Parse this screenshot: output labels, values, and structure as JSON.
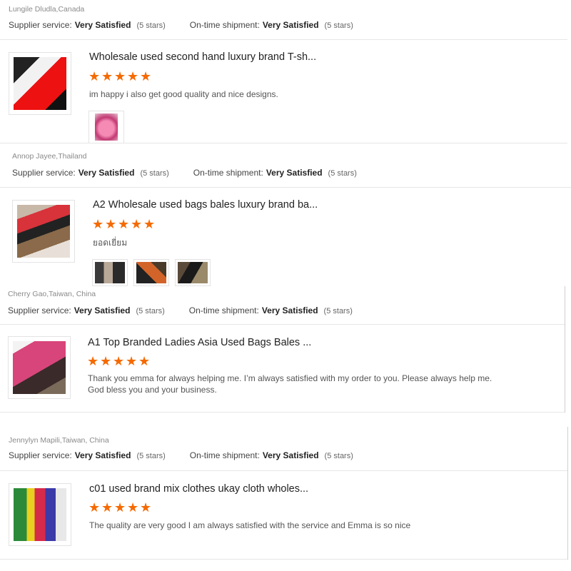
{
  "labels": {
    "supplier_service": "Supplier service:",
    "on_time_shipment": "On-time shipment:",
    "stars_note": "(5 stars)"
  },
  "reviews": [
    {
      "reviewer": "Lungile Dludla,Canada",
      "supplier_value": "Very Satisfied",
      "shipment_value": "Very Satisfied",
      "product_title": "Wholesale used second hand luxury brand T-sh...",
      "rating": 5,
      "comment": "im happy i also get good quality and nice designs.",
      "photo_count": 1
    },
    {
      "reviewer": "Annop Jayee,Thailand",
      "supplier_value": "Very Satisfied",
      "shipment_value": "Very Satisfied",
      "product_title": "A2 Wholesale used bags bales luxury brand ba...",
      "rating": 5,
      "comment": "ยอดเยี่ยม",
      "photo_count": 3
    },
    {
      "reviewer": "Cherry Gao,Taiwan, China",
      "supplier_value": "Very Satisfied",
      "shipment_value": "Very Satisfied",
      "product_title": "A1 Top Branded Ladies Asia Used Bags Bales ...",
      "rating": 5,
      "comment": "Thank you emma for always helping me. I’m always satisfied with my order to you. Please always help me. God bless you and your business.",
      "photo_count": 0
    },
    {
      "reviewer": "Jennylyn Mapili,Taiwan, China",
      "supplier_value": "Very Satisfied",
      "shipment_value": "Very Satisfied",
      "product_title": "c01 used brand mix clothes ukay cloth wholes...",
      "rating": 5,
      "comment": "The quality are very good I am always satisfied with the service and Emma is so nice",
      "photo_count": 0
    }
  ],
  "colors": {
    "star": "#f56a00",
    "border": "#e6e6e6"
  },
  "icons": {
    "star": "star-icon"
  }
}
